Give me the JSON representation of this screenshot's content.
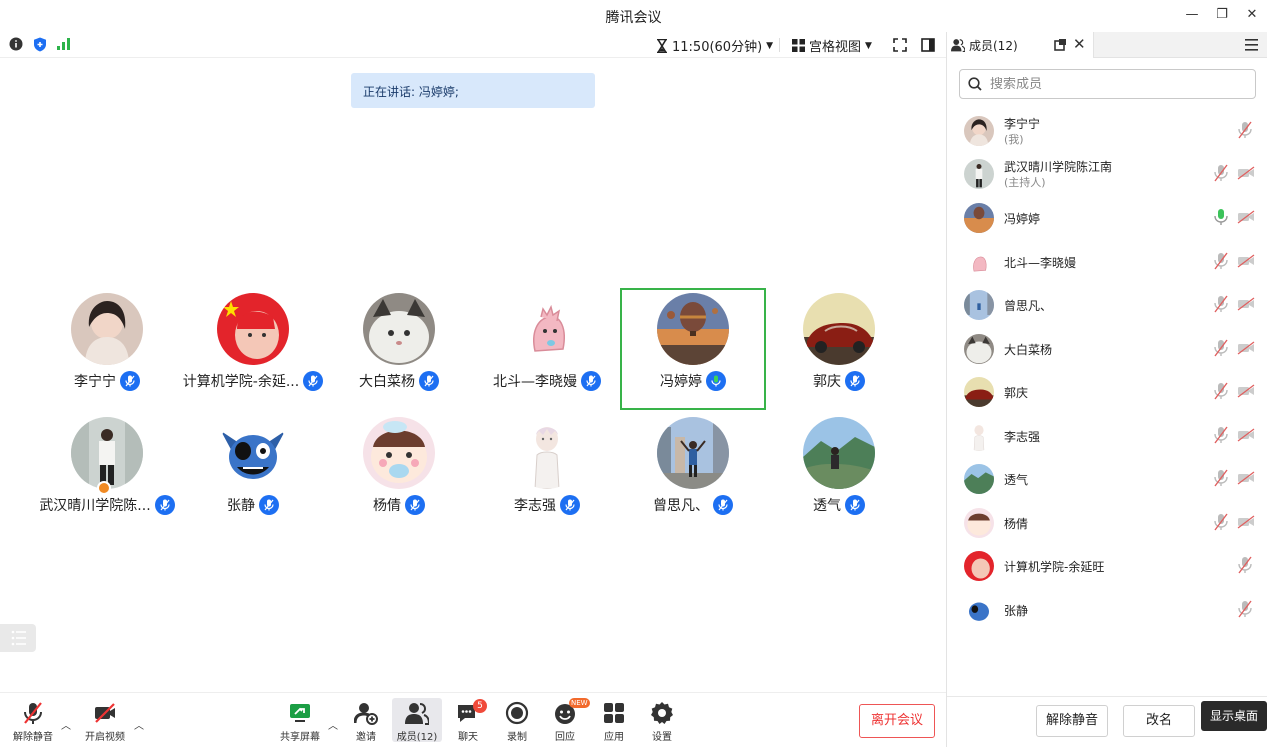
{
  "window": {
    "title": "腾讯会议"
  },
  "topbar": {
    "timer": "11:50(60分钟)",
    "view": "宫格视图"
  },
  "speaking": "正在讲话: 冯婷婷;",
  "tiles": [
    {
      "name": "李宁宁"
    },
    {
      "name": "计算机学院-余延..."
    },
    {
      "name": "大白菜杨"
    },
    {
      "name": "北斗—李晓嫚"
    },
    {
      "name": "冯婷婷"
    },
    {
      "name": "郭庆"
    },
    {
      "name": "武汉晴川学院陈..."
    },
    {
      "name": "张静"
    },
    {
      "name": "杨倩"
    },
    {
      "name": "李志强"
    },
    {
      "name": "曾思凡、"
    },
    {
      "name": "透气"
    }
  ],
  "toolbar": {
    "unmute": "解除静音",
    "video": "开启视频",
    "share": "共享屏幕",
    "invite": "邀请",
    "members": "成员(12)",
    "chat": "聊天",
    "chat_badge": "5",
    "record": "录制",
    "react": "回应",
    "react_badge": "NEW",
    "apps": "应用",
    "settings": "设置",
    "leave": "离开会议"
  },
  "panel": {
    "tab": "成员(12)",
    "search_placeholder": "搜索成员",
    "members": [
      {
        "name": "李宁宁",
        "role": "(我)"
      },
      {
        "name": "武汉晴川学院陈江南",
        "role": "(主持人)"
      },
      {
        "name": "冯婷婷"
      },
      {
        "name": "北斗—李晓嫚"
      },
      {
        "name": "曾思凡、"
      },
      {
        "name": "大白菜杨"
      },
      {
        "name": "郭庆"
      },
      {
        "name": "李志强"
      },
      {
        "name": "透气"
      },
      {
        "name": "杨倩"
      },
      {
        "name": "计算机学院-余延旺"
      },
      {
        "name": "张静"
      }
    ],
    "unmute_all": "解除静音",
    "rename": "改名"
  },
  "tooltip": "显示桌面",
  "colors": {
    "accent": "#1d6ff2",
    "speaking_border": "#38b349",
    "leave": "#e33333"
  }
}
